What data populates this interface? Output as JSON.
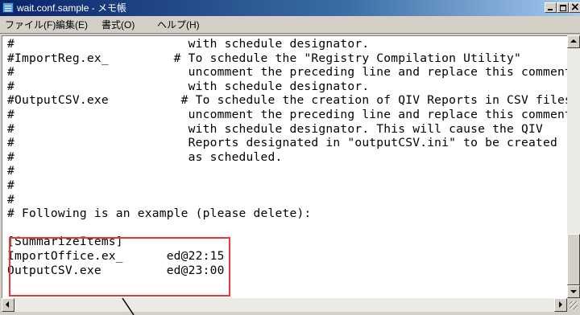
{
  "window": {
    "title": "wait.conf.sample - メモ帳",
    "icon": "notepad-icon"
  },
  "menubar": {
    "items": [
      {
        "label": "ファイル(F)"
      },
      {
        "label": "編集(E)"
      },
      {
        "label": "書式(O)"
      },
      {
        "label": "ヘルプ(H)"
      }
    ]
  },
  "editor": {
    "lines": [
      "#                        with schedule designator.",
      "#ImportReg.ex_         # To schedule the \"Registry Compilation Utility\"",
      "#                        uncomment the preceding line and replace this comment",
      "#                        with schedule designator.",
      "#OutputCSV.exe          # To schedule the creation of QIV Reports in CSV files",
      "#                        uncomment the preceding line and replace this comment",
      "#                        with schedule designator. This will cause the QIV",
      "#                        Reports designated in \"outputCSV.ini\" to be created",
      "#                        as scheduled.",
      "#",
      "#",
      "#",
      "# Following is an example (please delete):",
      "",
      "[SummarizeItems]",
      "ImportOffice.ex_      ed@22:15",
      "OutputCSV.exe         ed@23:00"
    ]
  },
  "colors": {
    "highlight_border": "#e8393a",
    "title_active": "#0a246a"
  }
}
